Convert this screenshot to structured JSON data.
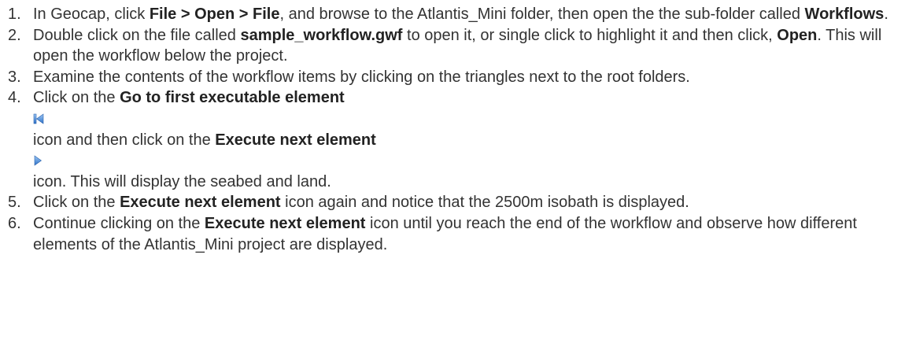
{
  "steps": [
    {
      "number": "1.",
      "text_a": "In Geocap, click ",
      "bold_a": "File > Open > File",
      "text_b": ", and browse to the Atlantis_Mini folder, then open the the sub-folder called ",
      "bold_b": "Workflows",
      "text_c": "."
    },
    {
      "number": "2.",
      "text_a": "Double click on the file called ",
      "bold_a": "sample_workflow.gwf",
      "text_b": " to open it, or single click to highlight it and then click, ",
      "bold_b": "Open",
      "text_c": ". This will open the workflow below the project."
    },
    {
      "number": "3.",
      "text_a": "Examine the contents of the workflow items by clicking on the triangles next to the root folders."
    },
    {
      "number": "4.",
      "text_a": "Click on the ",
      "bold_a": "Go to first executable element",
      "icon_a": "go-to-first-icon",
      "text_b": "icon and then click on the ",
      "bold_b": "Execute next element",
      "icon_b": "execute-next-icon",
      "text_c": "icon. This will display the seabed and land."
    },
    {
      "number": "5.",
      "text_a": "Click on the ",
      "bold_a": "Execute next element",
      "text_b": " icon again and notice that the 2500m isobath is displayed."
    },
    {
      "number": "6.",
      "text_a": "Continue clicking on the ",
      "bold_a": "Execute next element",
      "text_b": " icon until you reach the end of the workflow and observe how different elements of the Atlantis_Mini project are displayed."
    }
  ],
  "colors": {
    "text": "#333333",
    "icon_blue": "#3a7fd6"
  }
}
